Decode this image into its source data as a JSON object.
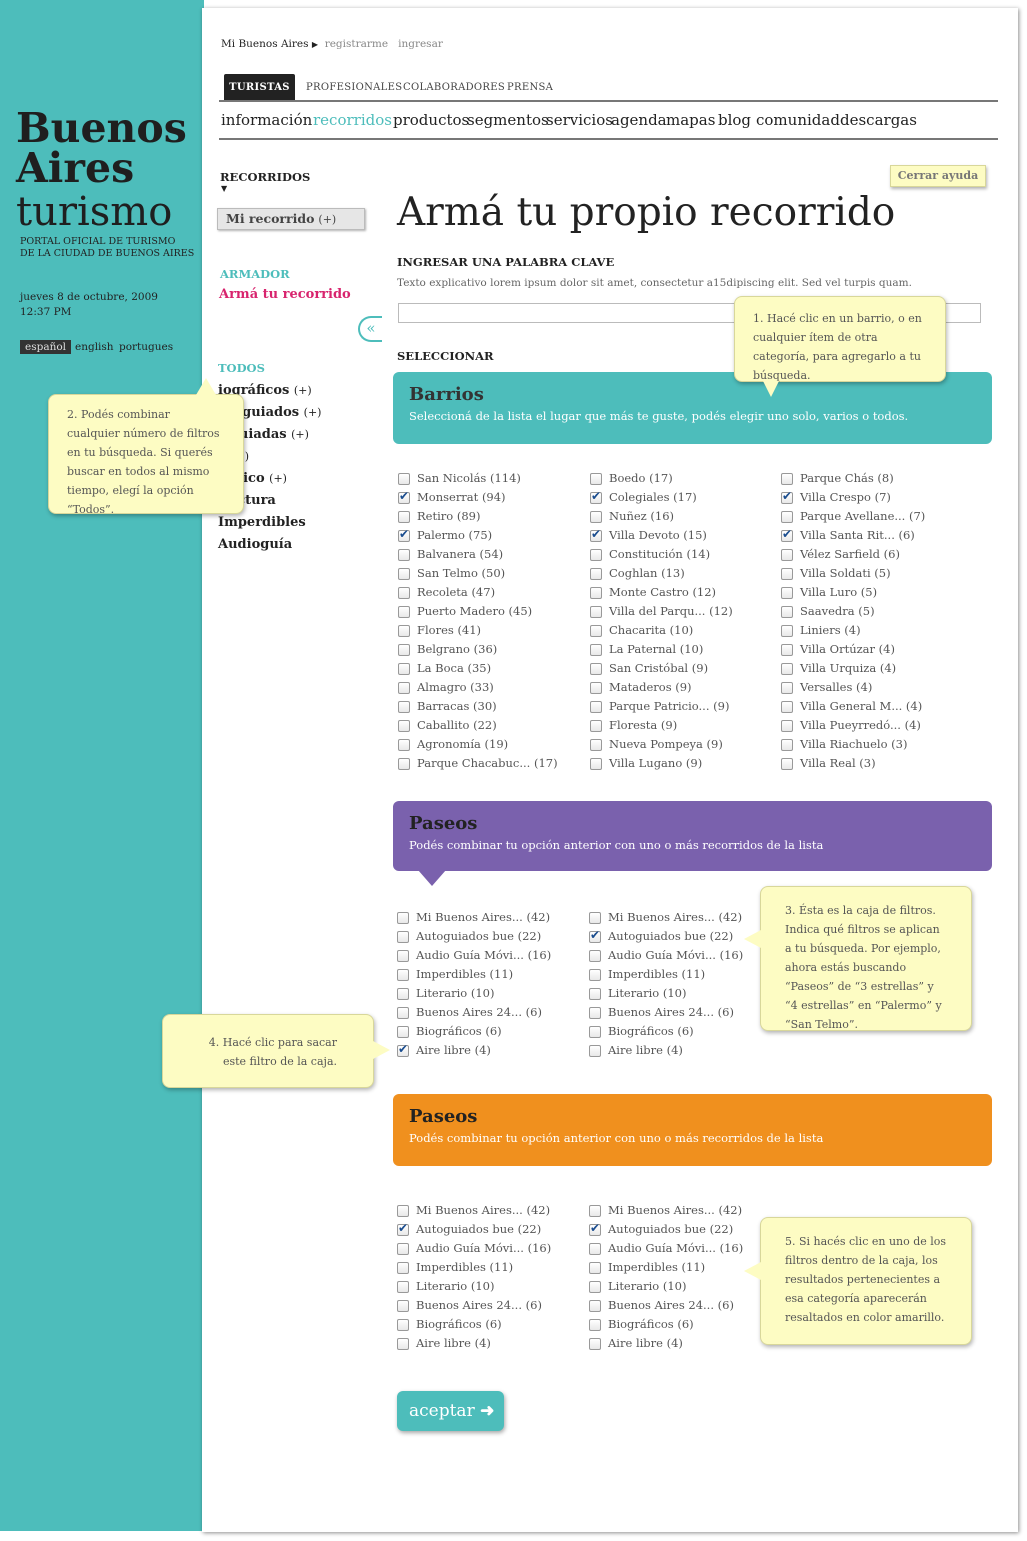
{
  "sidebar": {
    "logo_line1": "Buenos",
    "logo_line2": "Aires",
    "logo_line3": "turismo",
    "subtitle_1": "PORTAL OFICIAL DE TURISMO",
    "subtitle_2": "DE LA CIUDAD DE BUENOS AIRES",
    "date": "jueves 8 de octubre, 2009",
    "time": "12:37 PM",
    "languages": [
      "español",
      "english",
      "portugues"
    ]
  },
  "topnav": {
    "my": "Mi Buenos Aires",
    "register": "registrarme",
    "login": "ingresar"
  },
  "tabs": [
    "TURISTAS",
    "PROFESIONALES",
    "COLABORADORES",
    "PRENSA"
  ],
  "mainnav": [
    "información",
    "recorridos",
    "productos",
    "segmentos",
    "servicios",
    "agenda",
    "mapas",
    "blog",
    "comunidad",
    "descargas"
  ],
  "leftmenu": {
    "title": "RECORRIDOS",
    "mine": "Mi recorrido",
    "plus": "(+)",
    "armador": "ARMADOR",
    "arma": "Armá tu recorrido",
    "todos": "TODOS",
    "items": [
      "iográficos",
      "utoguiados",
      "s guiadas",
      "o",
      "rístico",
      "itectura",
      "Imperdibles",
      "Audioguía"
    ],
    "item_plus": [
      "(+)",
      "(+)",
      "(+)",
      "(+)",
      "(+)",
      "",
      "",
      ""
    ],
    "collapse": "«"
  },
  "content": {
    "close_help": "Cerrar ayuda",
    "title": "Armá tu propio recorrido",
    "keyword_label": "INGRESAR UNA PALABRA CLAVE",
    "keyword_help": "Texto explicativo lorem ipsum dolor sit amet, consectetur a15dipiscing elit. Sed vel turpis quam.",
    "select_label": "SELECCIONAR",
    "accept": "aceptar"
  },
  "barrios": {
    "title": "Barrios",
    "desc": "Seleccioná de la lista el lugar que más te guste, podés elegir uno solo, varios o todos.",
    "color": "#4dbdbb",
    "cols": [
      [
        [
          "San Nicolás (114)",
          0
        ],
        [
          "Monserrat (94)",
          1
        ],
        [
          "Retiro (89)",
          0
        ],
        [
          "Palermo (75)",
          1
        ],
        [
          "Balvanera (54)",
          0
        ],
        [
          "San Telmo (50)",
          0
        ],
        [
          "Recoleta (47)",
          0
        ],
        [
          "Puerto Madero (45)",
          0
        ],
        [
          "Flores (41)",
          0
        ],
        [
          "Belgrano (36)",
          0
        ],
        [
          "La Boca (35)",
          0
        ],
        [
          "Almagro (33)",
          0
        ],
        [
          "Barracas (30)",
          0
        ],
        [
          "Caballito (22)",
          0
        ],
        [
          "Agronomía (19)",
          0
        ],
        [
          "Parque Chacabuc... (17)",
          0
        ]
      ],
      [
        [
          "Boedo (17)",
          0
        ],
        [
          "Colegiales (17)",
          1
        ],
        [
          "Nuñez (16)",
          0
        ],
        [
          "Villa Devoto (15)",
          1
        ],
        [
          "Constitución (14)",
          0
        ],
        [
          "Coghlan (13)",
          0
        ],
        [
          "Monte Castro (12)",
          0
        ],
        [
          "Villa del Parqu... (12)",
          0
        ],
        [
          "Chacarita (10)",
          0
        ],
        [
          "La Paternal (10)",
          0
        ],
        [
          "San Cristóbal (9)",
          0
        ],
        [
          "Mataderos (9)",
          0
        ],
        [
          "Parque Patricio... (9)",
          0
        ],
        [
          "Floresta (9)",
          0
        ],
        [
          "Nueva Pompeya (9)",
          0
        ],
        [
          "Villa Lugano (9)",
          0
        ]
      ],
      [
        [
          "Parque Chás (8)",
          0
        ],
        [
          "Villa Crespo (7)",
          1
        ],
        [
          "Parque Avellane... (7)",
          0
        ],
        [
          "Villa Santa Rit... (6)",
          1
        ],
        [
          "Vélez Sarfield (6)",
          0
        ],
        [
          "Villa Soldati (5)",
          0
        ],
        [
          "Villa Luro (5)",
          0
        ],
        [
          "Saavedra (5)",
          0
        ],
        [
          "Liniers (4)",
          0
        ],
        [
          "Villa Ortúzar (4)",
          0
        ],
        [
          "Villa Urquiza (4)",
          0
        ],
        [
          "Versalles (4)",
          0
        ],
        [
          "Villa General M... (4)",
          0
        ],
        [
          "Villa Pueyrredó... (4)",
          0
        ],
        [
          "Villa Riachuelo (3)",
          0
        ],
        [
          "Villa Real (3)",
          0
        ]
      ]
    ]
  },
  "paseos1": {
    "title": "Paseos",
    "desc": "Podés combinar tu opción anterior con uno o más  recorridos de la lista",
    "color": "#7a61ad",
    "cols": [
      [
        [
          "Mi Buenos Aires... (42)",
          0
        ],
        [
          "Autoguiados bue (22)",
          0
        ],
        [
          "Audio Guía Móvi... (16)",
          0
        ],
        [
          "Imperdibles (11)",
          0
        ],
        [
          "Literario (10)",
          0
        ],
        [
          "Buenos Aires 24... (6)",
          0
        ],
        [
          "Biográficos (6)",
          0
        ],
        [
          "Aire libre (4)",
          1
        ]
      ],
      [
        [
          "Mi Buenos Aires... (42)",
          0
        ],
        [
          "Autoguiados bue (22)",
          1
        ],
        [
          "Audio Guía Móvi... (16)",
          0
        ],
        [
          "Imperdibles (11)",
          0
        ],
        [
          "Literario (10)",
          0
        ],
        [
          "Buenos Aires 24... (6)",
          0
        ],
        [
          "Biográficos (6)",
          0
        ],
        [
          "Aire libre (4)",
          0
        ]
      ]
    ]
  },
  "paseos2": {
    "title": "Paseos",
    "desc": "Podés combinar tu opción anterior con uno o más  recorridos de la lista",
    "color": "#f0901e",
    "cols": [
      [
        [
          "Mi Buenos Aires... (42)",
          0
        ],
        [
          "Autoguiados bue (22)",
          1
        ],
        [
          "Audio Guía Móvi... (16)",
          0
        ],
        [
          "Imperdibles (11)",
          0
        ],
        [
          "Literario (10)",
          0
        ],
        [
          "Buenos Aires 24... (6)",
          0
        ],
        [
          "Biográficos (6)",
          0
        ],
        [
          "Aire libre (4)",
          0
        ]
      ],
      [
        [
          "Mi Buenos Aires... (42)",
          0
        ],
        [
          "Autoguiados bue (22)",
          1
        ],
        [
          "Audio Guía Móvi... (16)",
          0
        ],
        [
          "Imperdibles (11)",
          0
        ],
        [
          "Literario (10)",
          0
        ],
        [
          "Buenos Aires 24... (6)",
          0
        ],
        [
          "Biográficos (6)",
          0
        ],
        [
          "Aire libre (4)",
          0
        ]
      ]
    ]
  },
  "notes": {
    "n1": "1. Hacé clic en un barrio, o en cualquier ítem de otra categoría, para agregarlo a tu búsqueda.",
    "n2": "2. Podés combinar cualquier número de filtros en tu búsqueda. Si querés buscar en todos al mismo tiempo, elegí la opción “Todos”.",
    "n3": "3. Ésta es la caja de filtros. Indica qué filtros se aplican a tu búsqueda. Por ejemplo, ahora estás buscando “Paseos” de “3 estrellas” y “4 estrellas” en “Palermo” y “San Telmo”.",
    "n4": "4. Hacé clic para sacar este filtro de la caja.",
    "n5": "5. Si hacés clic en uno de los filtros dentro de la caja, los resultados pertenecientes a esa categoría aparecerán resaltados en color amarillo."
  }
}
